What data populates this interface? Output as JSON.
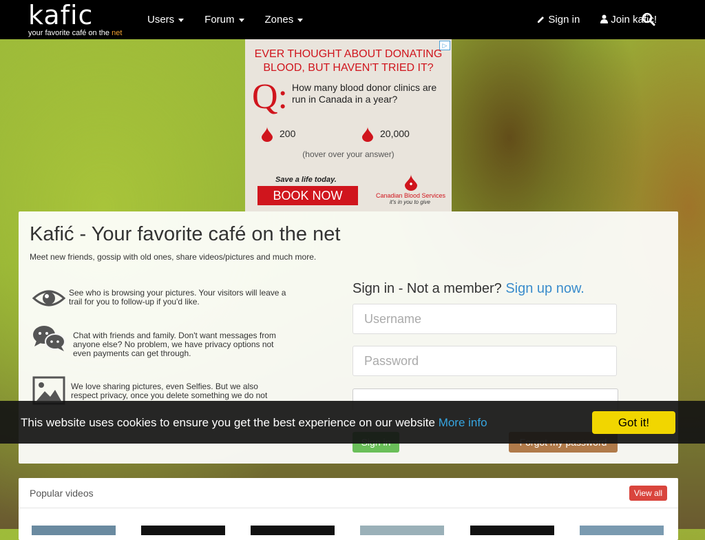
{
  "nav": {
    "logo_word": "kafic",
    "logo_tag_prefix": "your favorite café on the ",
    "logo_tag_accent": "net",
    "menu": [
      {
        "label": "Users"
      },
      {
        "label": "Forum"
      },
      {
        "label": "Zones"
      }
    ],
    "sign_in": "Sign in",
    "join": "Join kafic!"
  },
  "ad": {
    "headline_1": "EVER THOUGHT ABOUT DONATING",
    "headline_2": "BLOOD, BUT HAVEN'T TRIED IT?",
    "q_mark": "Q:",
    "question": "How many blood donor clinics are run in Canada in a year?",
    "answer_a": "200",
    "answer_b": "20,000",
    "hint": "(hover over your answer)",
    "save": "Save a life today.",
    "book": "BOOK NOW",
    "org": "Canadian Blood Services",
    "org_tag": "it's in you to give",
    "color_red": "#d0151d"
  },
  "main": {
    "title": "Kafić - Your favorite café on the net",
    "subtitle": "Meet new friends, gossip with old ones, share videos/pictures and much more.",
    "features": [
      {
        "text": "See who is browsing your pictures. Your visitors will leave a trail for you to follow-up if you'd like."
      },
      {
        "text": "Chat with friends and family. Don't want messages from anyone else? No problem, we have privacy options not even payments can get through."
      },
      {
        "text": "We love sharing pictures, even Selfies. But we also respect privacy, once you delete something we do not"
      }
    ],
    "signin_prefix": "Sign in - Not a member? ",
    "signup_link": "Sign up now.",
    "username_placeholder": "Username",
    "password_placeholder": "Password",
    "signin_button": "Sign in",
    "forgot_button": "Forgot my password"
  },
  "cookie": {
    "message": "This website uses cookies to ensure you get the best experience on our website ",
    "more_info": "More info",
    "button": "Got it!"
  },
  "videos": {
    "title": "Popular videos",
    "view_all": "View all"
  }
}
